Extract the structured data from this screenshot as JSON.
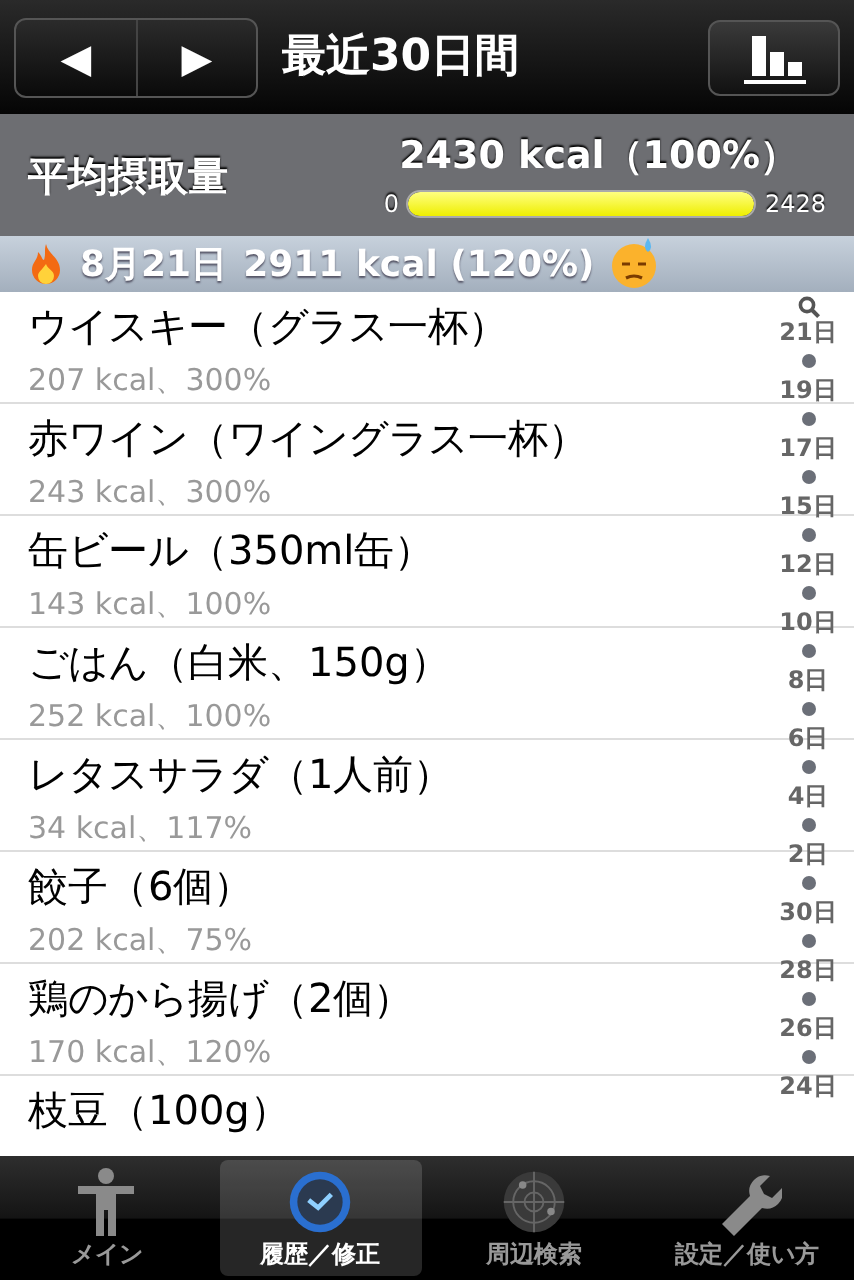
{
  "nav": {
    "prev": "◀",
    "next": "▶",
    "title": "最近30日間"
  },
  "summary": {
    "label": "平均摂取量",
    "value": "2430 kcal（100%）",
    "min": "0",
    "max": "2428",
    "level": 1.0
  },
  "day_header": {
    "date": "8月21日",
    "total": "2911 kcal (120%)"
  },
  "items": [
    {
      "name": "ウイスキー（グラス一杯）",
      "detail": "207 kcal、300%"
    },
    {
      "name": "赤ワイン（ワイングラス一杯）",
      "detail": "243 kcal、300%"
    },
    {
      "name": "缶ビール（350ml缶）",
      "detail": "143 kcal、100%"
    },
    {
      "name": "ごはん（白米、150g）",
      "detail": "252 kcal、100%"
    },
    {
      "name": "レタスサラダ（1人前）",
      "detail": "34 kcal、117%"
    },
    {
      "name": "餃子（6個）",
      "detail": "202 kcal、75%"
    },
    {
      "name": "鶏のから揚げ（2個）",
      "detail": "170 kcal、120%"
    },
    {
      "name": "枝豆（100g）"
    }
  ],
  "index": [
    "21日",
    "19日",
    "17日",
    "15日",
    "12日",
    "10日",
    "8日",
    "6日",
    "4日",
    "2日",
    "30日",
    "28日",
    "26日",
    "24日"
  ],
  "tabs": [
    {
      "label": "メイン",
      "kind": "person",
      "selected": false
    },
    {
      "label": "履歴／修正",
      "kind": "clock",
      "selected": true
    },
    {
      "label": "周辺検索",
      "kind": "radar",
      "selected": false
    },
    {
      "label": "設定／使い方",
      "kind": "wrench",
      "selected": false
    }
  ]
}
